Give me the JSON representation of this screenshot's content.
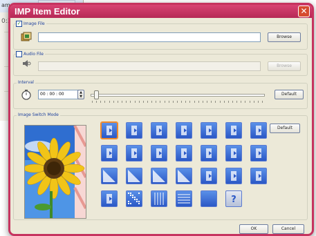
{
  "window": {
    "title": "IMP Item Editor"
  },
  "image_file": {
    "label": "Image File",
    "checked": true,
    "path": "",
    "browse_label": "Browse"
  },
  "audio_file": {
    "label": "Audio File",
    "checked": false,
    "path": "",
    "browse_label": "Browse"
  },
  "interval": {
    "label": "Interval",
    "time": "00 : 00 : 00",
    "default_label": "Default",
    "slider_value": 0.03
  },
  "switch_mode": {
    "label": "Image Switch Mode",
    "default_label": "Default",
    "selected_index": 0
  },
  "footer": {
    "ok_label": "OK",
    "cancel_label": "Cancel"
  },
  "background_window": {
    "title": "ame",
    "text": "0:3"
  },
  "colors": {
    "title_bar": "#c6335f",
    "accent": "#f08a2a",
    "tile_blue": "#3a6bd8"
  }
}
